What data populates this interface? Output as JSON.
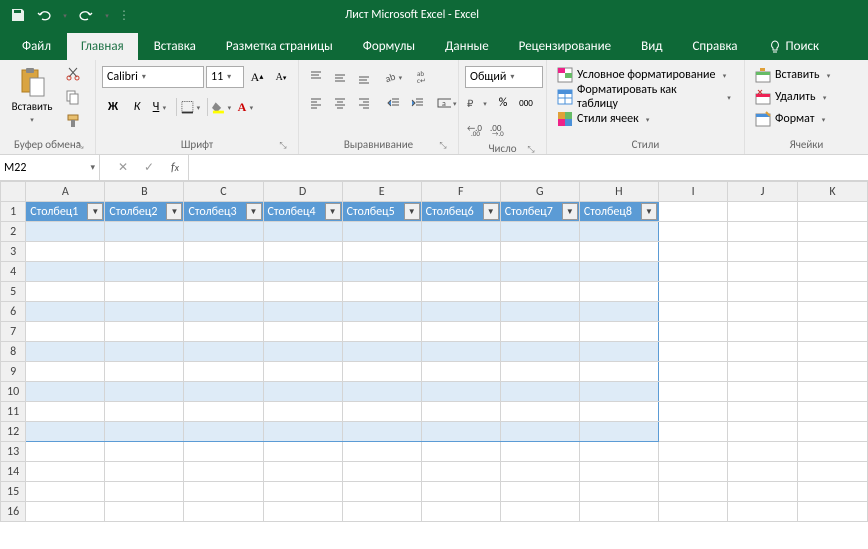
{
  "title": "Лист Microsoft Excel  -  Excel",
  "tabs": {
    "file": "Файл",
    "home": "Главная",
    "insert": "Вставка",
    "page_layout": "Разметка страницы",
    "formulas": "Формулы",
    "data": "Данные",
    "review": "Рецензирование",
    "view": "Вид",
    "help": "Справка",
    "search": "Поиск"
  },
  "ribbon": {
    "clipboard": {
      "label": "Буфер обмена",
      "paste": "Вставить"
    },
    "font": {
      "label": "Шрифт",
      "name": "Calibri",
      "size": "11",
      "bold": "Ж",
      "italic": "К",
      "underline": "Ч"
    },
    "alignment": {
      "label": "Выравнивание"
    },
    "number": {
      "label": "Число",
      "format": "Общий"
    },
    "styles": {
      "label": "Стили",
      "conditional": "Условное форматирование",
      "format_table": "Форматировать как таблицу",
      "cell_styles": "Стили ячеек"
    },
    "cells": {
      "label": "Ячейки",
      "insert": "Вставить",
      "delete": "Удалить",
      "format": "Формат"
    }
  },
  "name_box": "M22",
  "columns": [
    "A",
    "B",
    "C",
    "D",
    "E",
    "F",
    "G",
    "H",
    "I",
    "J",
    "K"
  ],
  "rows": [
    "1",
    "2",
    "3",
    "4",
    "5",
    "6",
    "7",
    "8",
    "9",
    "10",
    "11",
    "12",
    "13",
    "14",
    "15",
    "16"
  ],
  "table_headers": [
    "Столбец1",
    "Столбец2",
    "Столбец3",
    "Столбец4",
    "Столбец5",
    "Столбец6",
    "Столбец7",
    "Столбец8"
  ],
  "table_cols": 8,
  "table_rows": 12
}
